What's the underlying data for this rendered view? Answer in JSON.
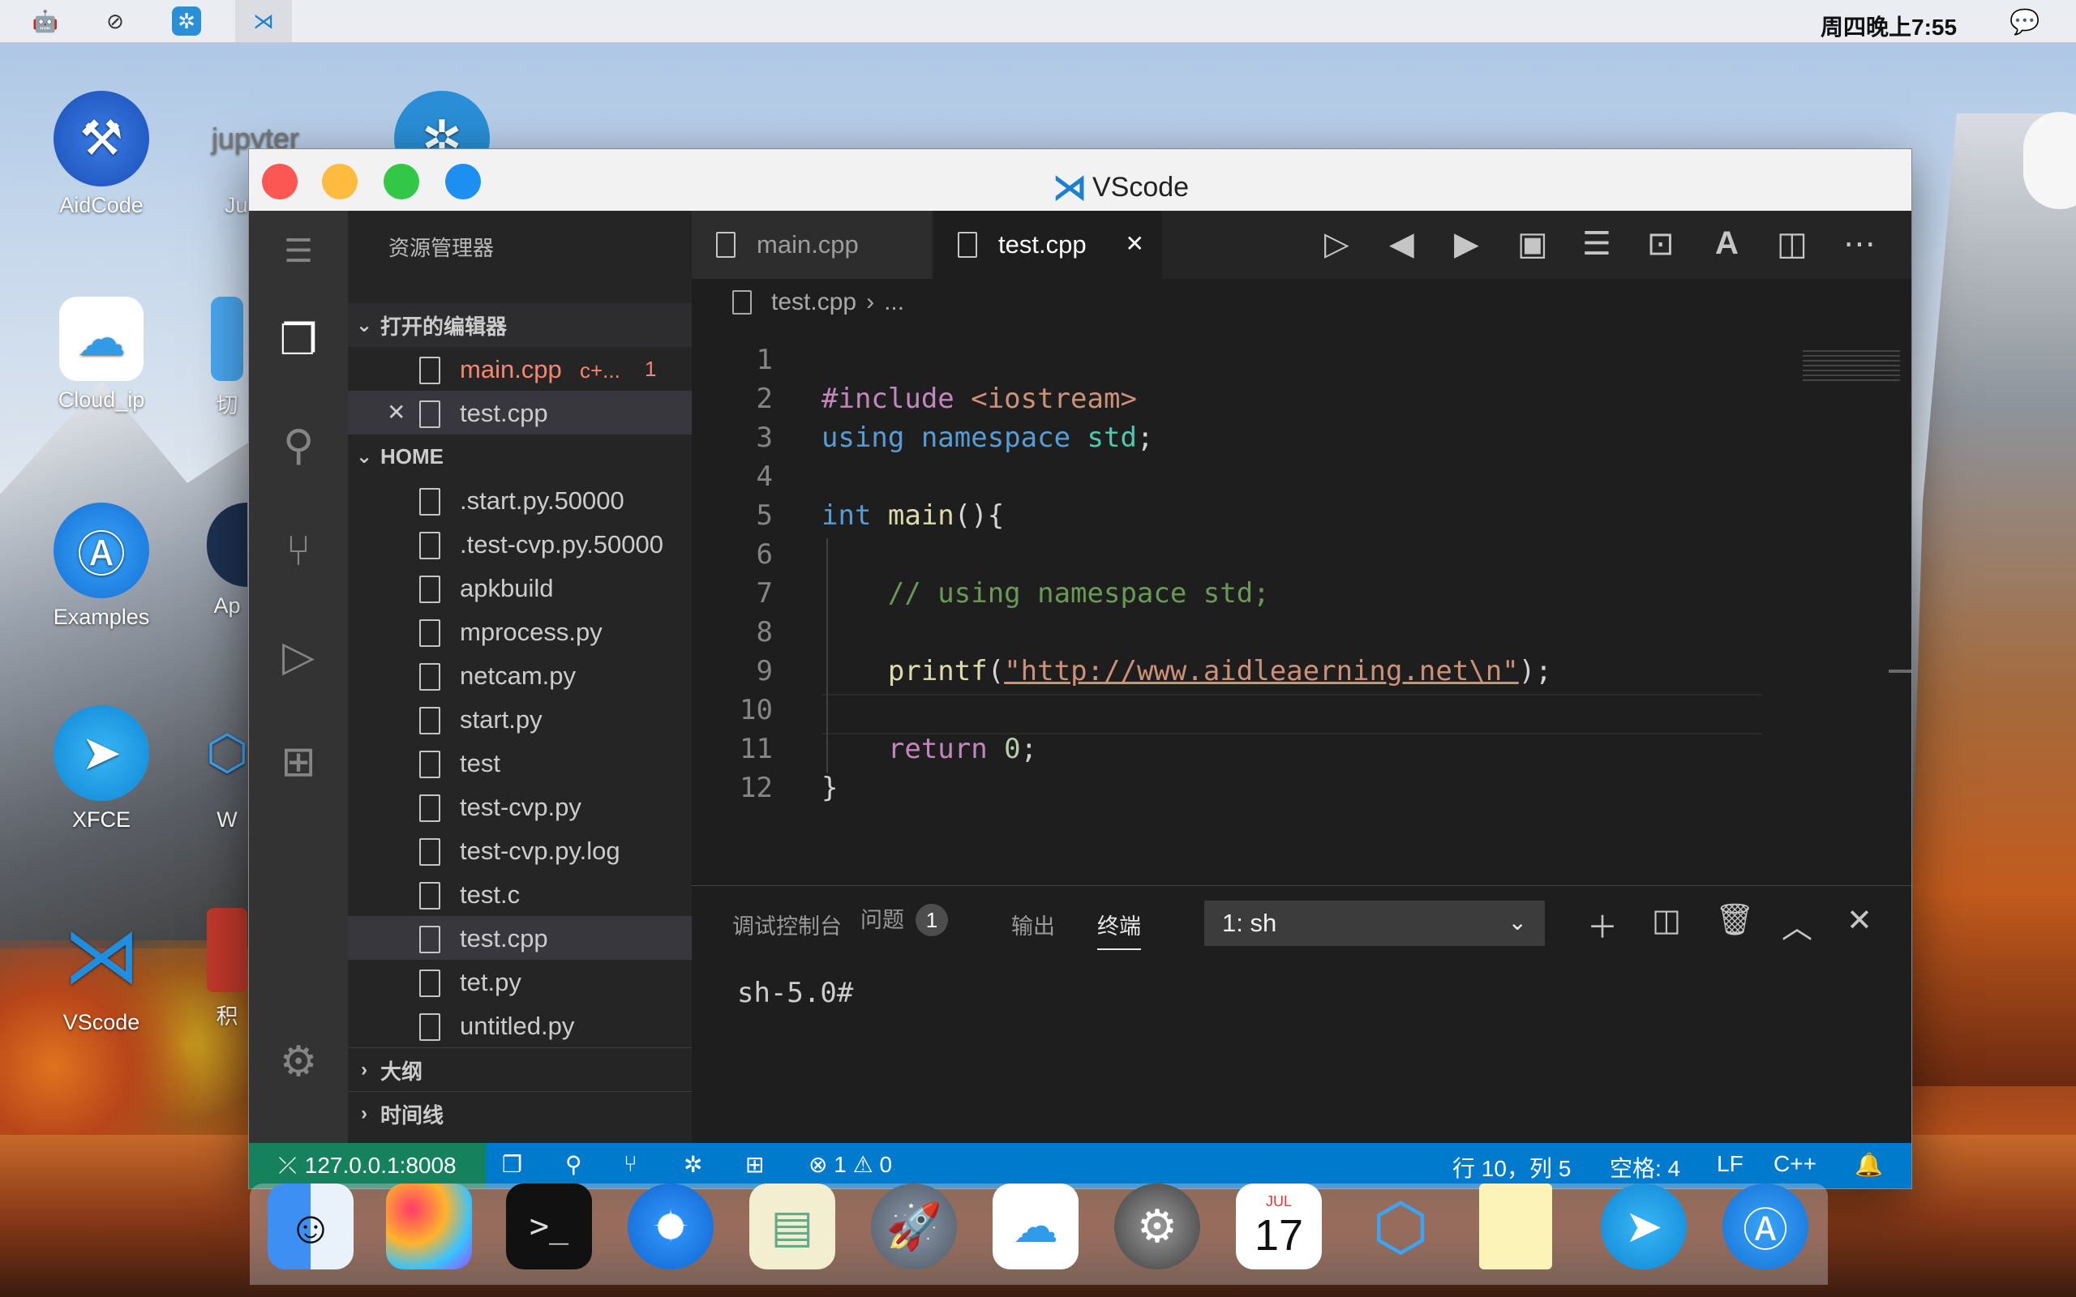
{
  "menubar": {
    "clock": "周四晚上7:55",
    "icons": [
      "android-icon",
      "compass-icon",
      "gear-app-icon",
      "vscode-icon"
    ]
  },
  "desktop": {
    "icons": [
      {
        "label": "AidCode"
      },
      {
        "label": "Ju"
      },
      {
        "label": "Cloud_ip"
      },
      {
        "label": "切"
      },
      {
        "label": "Examples"
      },
      {
        "label": "Ap"
      },
      {
        "label": "XFCE"
      },
      {
        "label": "W"
      },
      {
        "label": "VScode"
      },
      {
        "label": "积"
      }
    ],
    "jupyter_label": "jupyter"
  },
  "window": {
    "title": "VScode"
  },
  "sidebar": {
    "title": "资源管理器",
    "open_editors_label": "打开的编辑器",
    "open_editors": [
      {
        "name": "main.cpp",
        "hint": "c+...",
        "count": "1"
      },
      {
        "name": "test.cpp",
        "close": "✕"
      }
    ],
    "home_label": "HOME",
    "files": [
      ".start.py.50000",
      ".test-cvp.py.50000",
      "apkbuild",
      "mprocess.py",
      "netcam.py",
      "start.py",
      "test",
      "test-cvp.py",
      "test-cvp.py.log",
      "test.c",
      "test.cpp",
      "tet.py",
      "untitled.py"
    ],
    "outline_label": "大纲",
    "timeline_label": "时间线"
  },
  "tabs": [
    {
      "label": "main.cpp"
    },
    {
      "label": "test.cpp",
      "close": "✕"
    }
  ],
  "breadcrumb": {
    "file": "test.cpp",
    "sep": "›",
    "more": "..."
  },
  "editor": {
    "line_numbers": [
      "1",
      "2",
      "3",
      "4",
      "5",
      "6",
      "7",
      "8",
      "9",
      "10",
      "11",
      "12"
    ]
  },
  "code": {
    "l2a": "#include",
    "l2b": " <iostream>",
    "l3a": "using",
    "l3b": " namespace",
    "l3c": " std",
    ";": ";",
    "l5a": "int",
    "l5b": " main",
    "l5c": "(){",
    "l7": "    // using namespace std;",
    "l9a": "    printf",
    "l9b": "(",
    "l9c": "\"http://www.aidleaerning.net\\n\"",
    "l9d": ");",
    "l11a": "    return",
    "l11b": " 0",
    "l11c": ";",
    "l12": "}"
  },
  "panel": {
    "tabs": [
      "调试控制台",
      "问题",
      "输出",
      "终端"
    ],
    "problems_count": "1",
    "terminal_select": "1: sh",
    "prompt": "sh-5.0#"
  },
  "status": {
    "remote": "127.0.0.1:8008",
    "errors": "1",
    "warnings": "0",
    "position": "行 10，列 5",
    "spaces": "空格: 4",
    "eol": "LF",
    "lang": "C++"
  },
  "dock": {
    "calendar_month": "JUL",
    "calendar_day": "17"
  }
}
